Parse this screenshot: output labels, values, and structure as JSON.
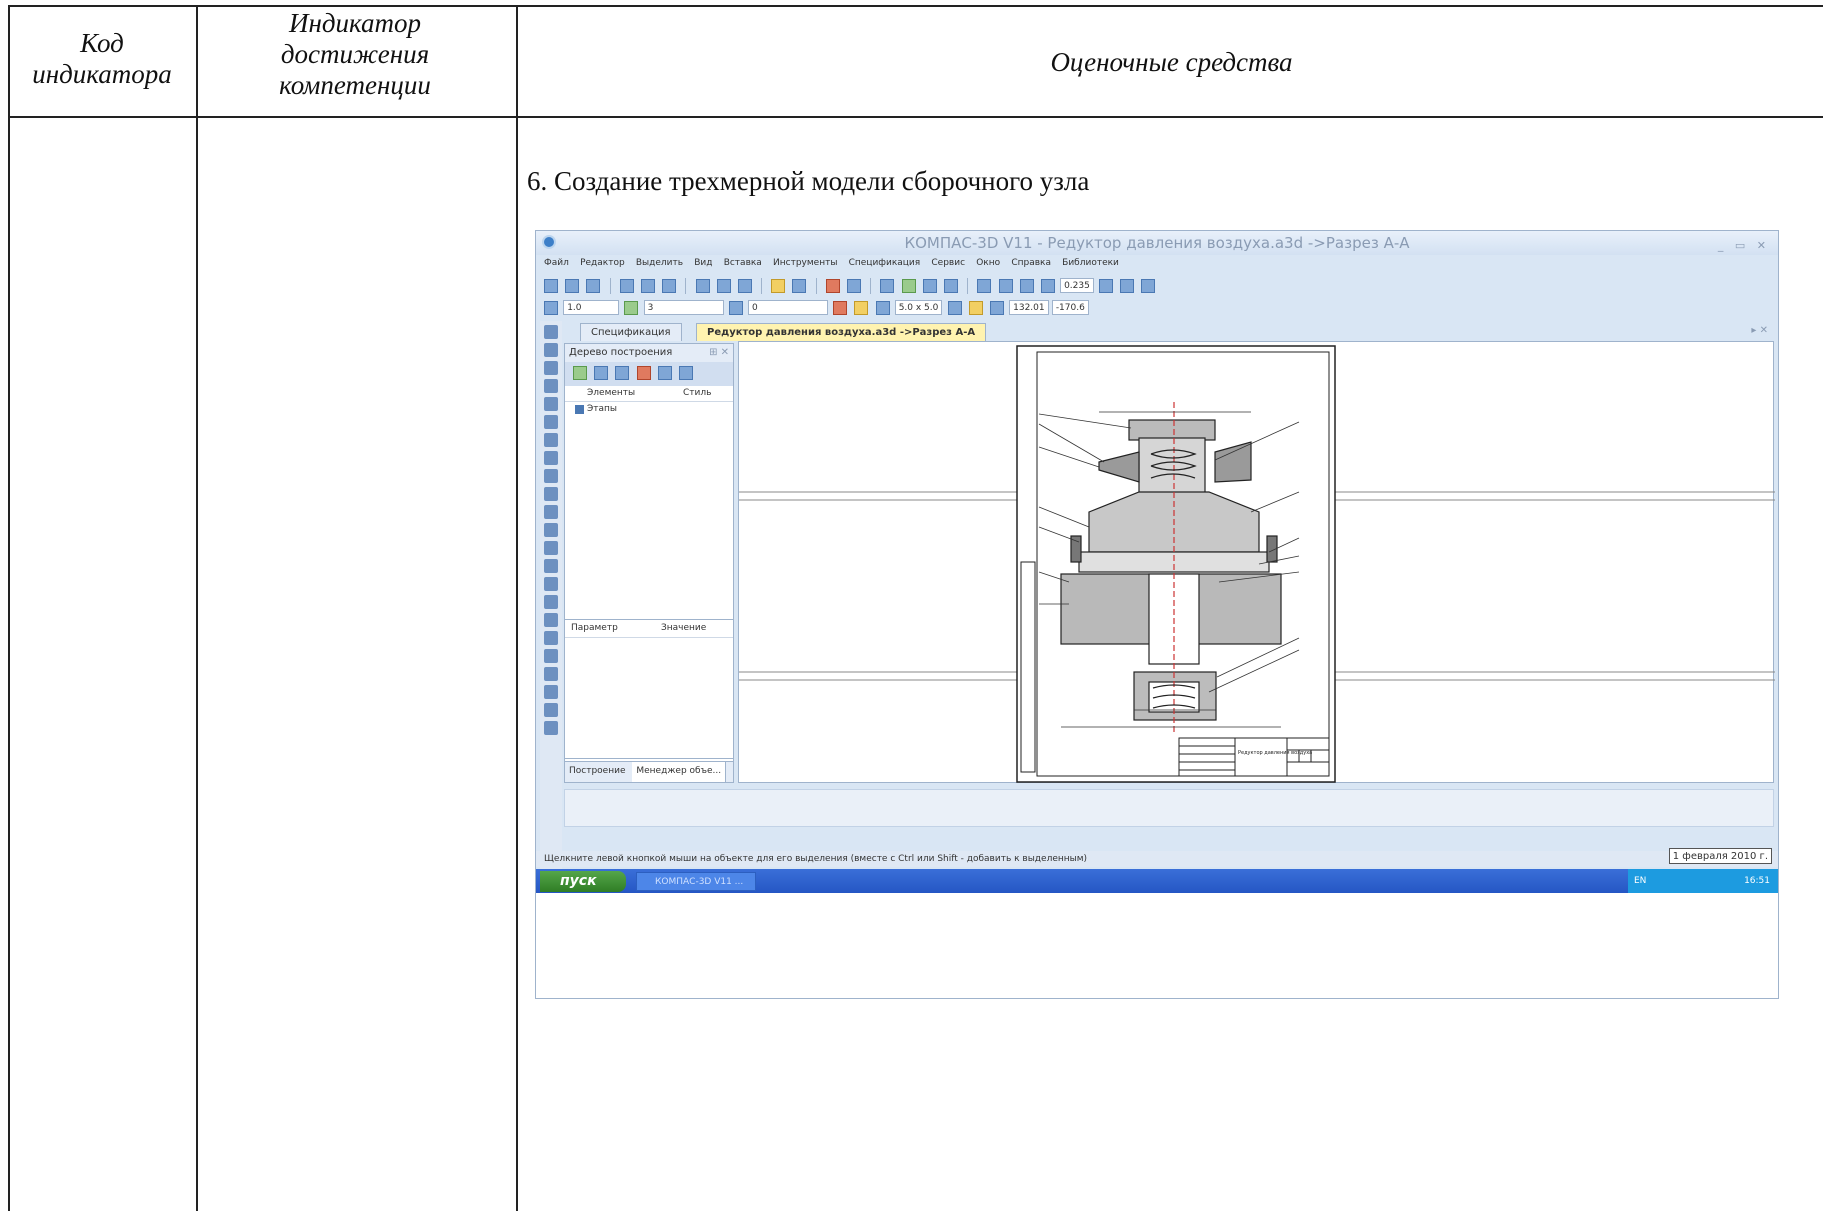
{
  "table": {
    "col_code": "Код индикатора",
    "col_indicator": "Индикатор достижения компетенции",
    "col_assessment": "Оценочные средства"
  },
  "content": {
    "item_title": "6. Создание трехмерной модели сборочного узла"
  },
  "screenshot": {
    "window_title": "КОМПАС-3D V11 - Редуктор давления воздуха.a3d ->Разрез А-А",
    "menu": [
      "Файл",
      "Редактор",
      "Выделить",
      "Вид",
      "Вставка",
      "Инструменты",
      "Спецификация",
      "Сервис",
      "Окно",
      "Справка",
      "Библиотеки"
    ],
    "toolbar": {
      "zoom": "0.235",
      "line_width": "1.0",
      "layer": "3",
      "style": "0",
      "grid": "5.0 x 5.0",
      "coord_x": "132.01",
      "coord_y": "-170.6"
    },
    "tabs": {
      "spec": "Спецификация",
      "document": "Редуктор давления воздуха.a3d ->Разрез А-А"
    },
    "tree": {
      "title": "Дерево построения",
      "col_elements": "Элементы",
      "col_style": "Стиль",
      "node": "Этапы"
    },
    "params": {
      "col_param": "Параметр",
      "col_value": "Значение"
    },
    "bottom_tabs": {
      "build": "Построение",
      "manager": "Менеджер объе..."
    },
    "status_text": "Щелкните левой кнопкой мыши на объекте для его выделения (вместе с Ctrl или Shift - добавить к выделенным)",
    "date": "1 февраля 2010 г.",
    "taskbar": {
      "start": "пуск",
      "task": "КОМПАС-3D V11 ...",
      "lang": "EN",
      "time": "16:51"
    },
    "drawing": {
      "title_block_text": "Редуктор давления воздуха"
    },
    "colors": {
      "accent_tab": "#fff3b0",
      "taskbar": "#2556c4",
      "start": "#3e9436"
    }
  }
}
